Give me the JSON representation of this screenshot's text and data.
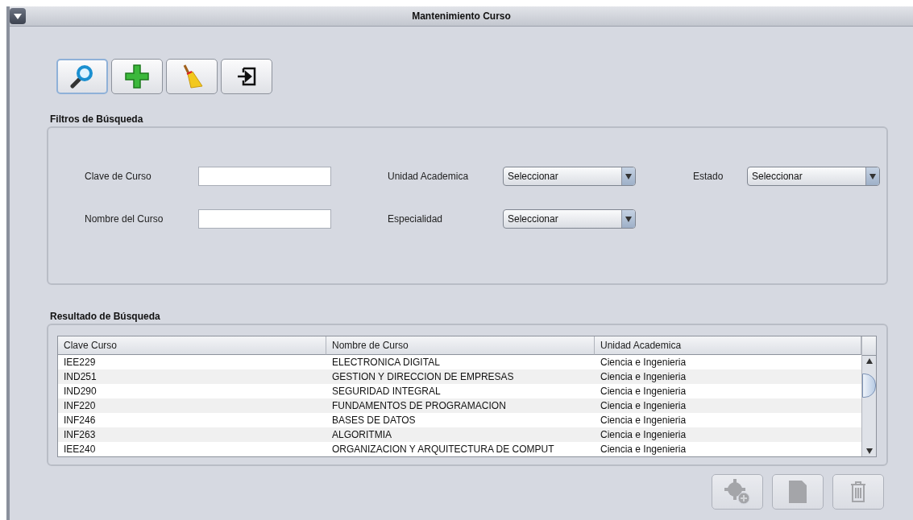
{
  "window": {
    "title": "Mantenimiento Curso"
  },
  "toolbar": [
    {
      "kind": "search",
      "focused": true
    },
    {
      "kind": "add",
      "focused": false
    },
    {
      "kind": "clear",
      "focused": false
    },
    {
      "kind": "exit",
      "focused": false
    }
  ],
  "filters": {
    "title": "Filtros de Búsqueda",
    "fields": [
      {
        "kind": "text",
        "label": "Clave de Curso"
      },
      {
        "kind": "combo",
        "label": "Unidad Academica",
        "value": "Seleccionar"
      },
      {
        "kind": "combo",
        "label": "Estado",
        "value": "Seleccionar"
      },
      {
        "kind": "text",
        "label": "Nombre del Curso"
      },
      {
        "kind": "combo",
        "label": "Especialidad",
        "value": "Seleccionar"
      }
    ]
  },
  "results": {
    "title": "Resultado de Búsqueda",
    "table": {
      "columns": [
        "Clave Curso",
        "Nombre de Curso",
        "Unidad Academica"
      ],
      "rows": [
        [
          "IEE229",
          "ELECTRONICA DIGITAL",
          "Ciencia e Ingenieria"
        ],
        [
          "IND251",
          "GESTION Y DIRECCION DE EMPRESAS",
          "Ciencia e Ingenieria"
        ],
        [
          "IND290",
          "SEGURIDAD INTEGRAL",
          "Ciencia e Ingenieria"
        ],
        [
          "INF220",
          "FUNDAMENTOS DE PROGRAMACION",
          "Ciencia e Ingenieria"
        ],
        [
          "INF246",
          "BASES DE DATOS",
          "Ciencia e Ingenieria"
        ],
        [
          "INF263",
          "ALGORITMIA",
          "Ciencia e Ingenieria"
        ],
        [
          "IEE240",
          "ORGANIZACION Y ARQUITECTURA DE COMPUT",
          "Ciencia e Ingenieria"
        ]
      ]
    }
  },
  "actions": [
    {
      "kind": "settings",
      "disabled": true
    },
    {
      "kind": "edit",
      "disabled": true
    },
    {
      "kind": "delete",
      "disabled": true
    }
  ]
}
